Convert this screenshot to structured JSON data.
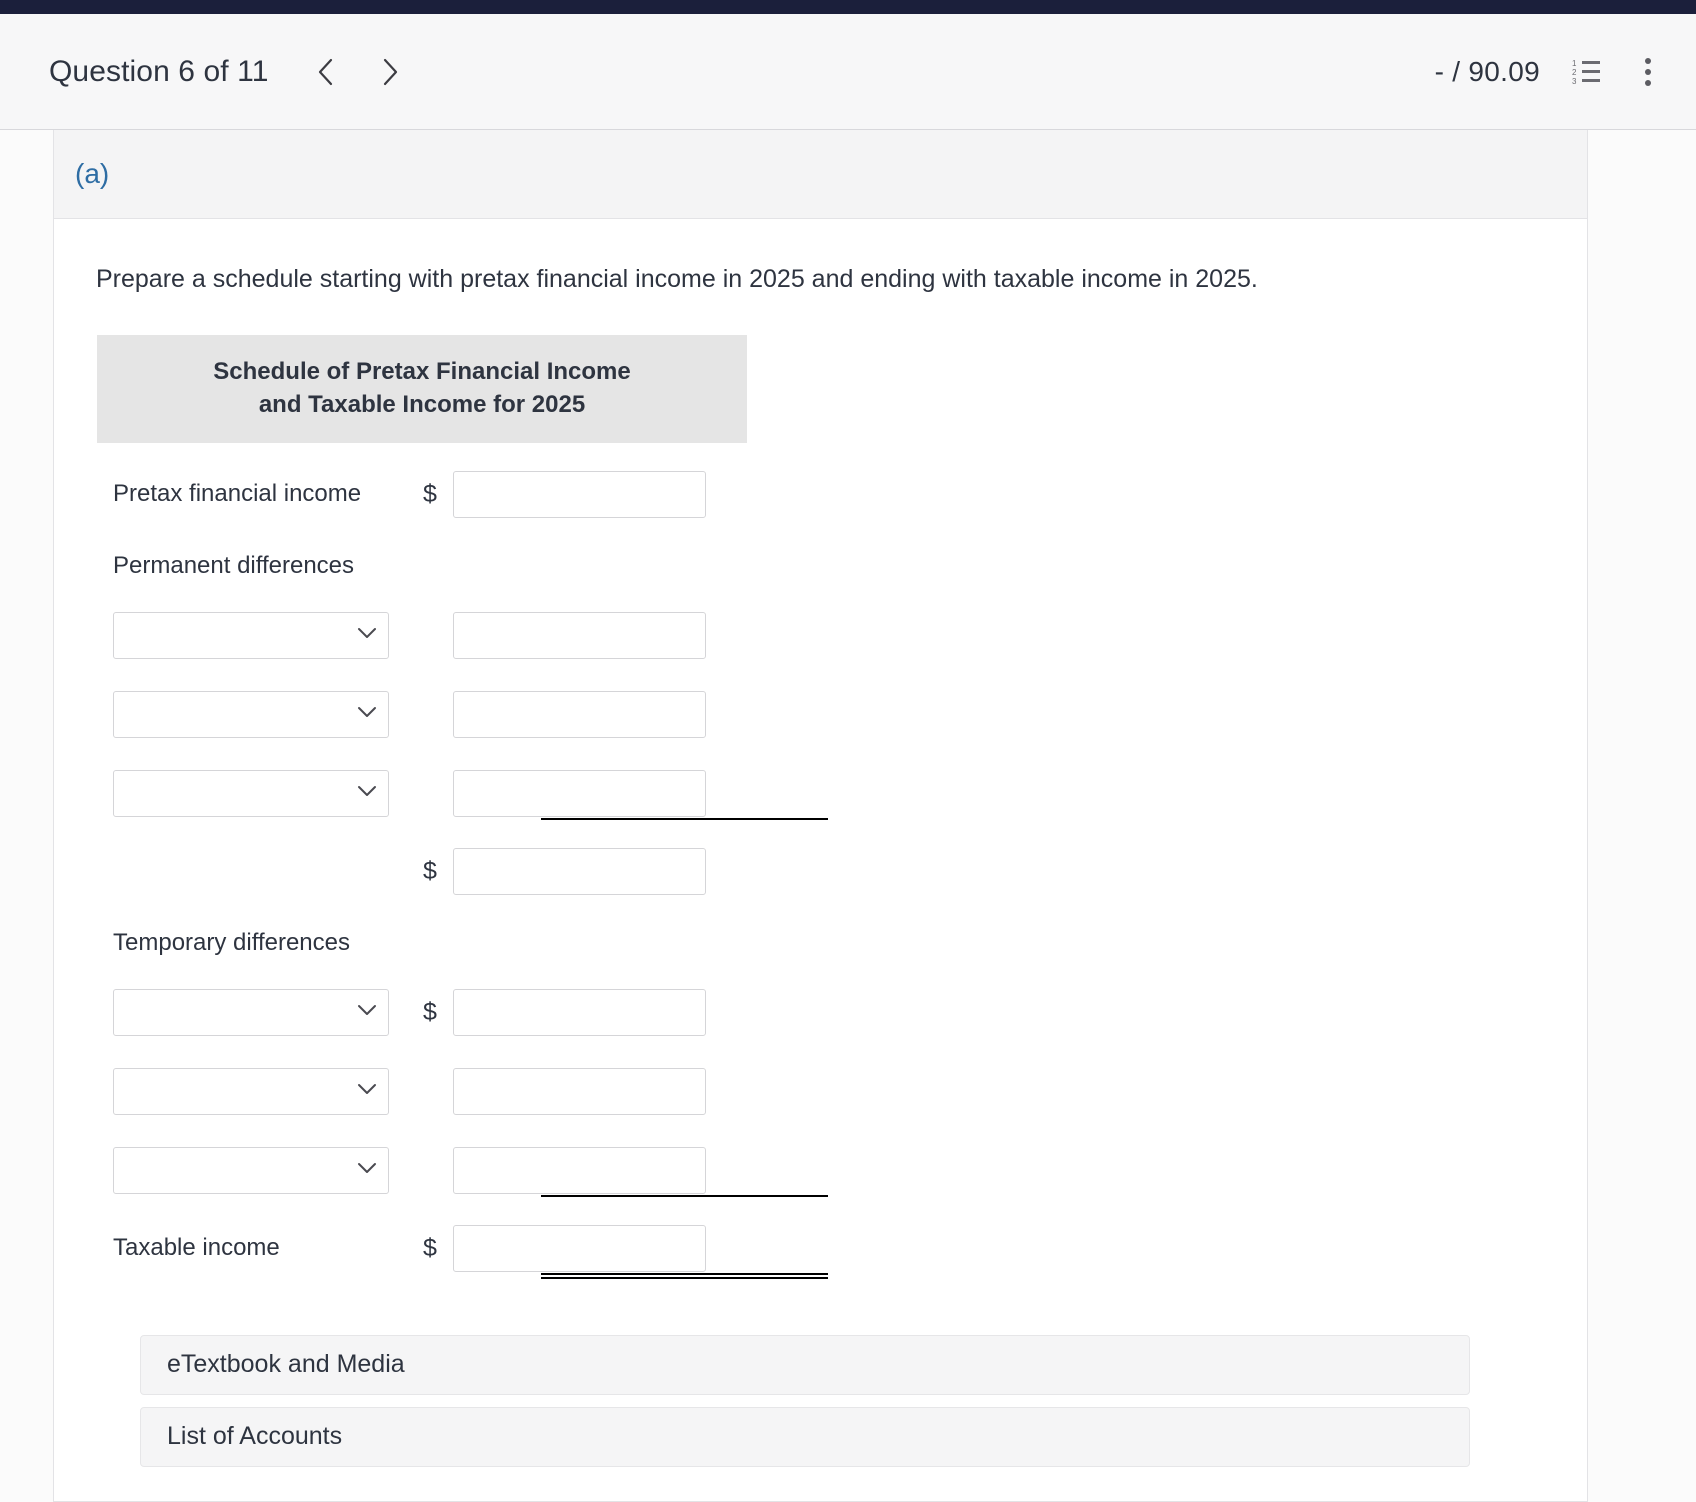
{
  "header": {
    "question_title": "Question 6 of 11",
    "prev_icon": "chevron-left-icon",
    "next_icon": "chevron-right-icon",
    "score": "- / 90.09",
    "list_icon": "numbered-list-icon",
    "menu_icon": "kebab-menu-icon"
  },
  "part": {
    "label": "(a)"
  },
  "content": {
    "instruction": "Prepare a schedule starting with pretax financial income in 2025 and ending with taxable income in 2025.",
    "schedule_title_line1": "Schedule of Pretax Financial Income",
    "schedule_title_line2": "and Taxable Income for 2025",
    "rows": {
      "pretax_label": "Pretax financial income",
      "pretax_dollar": "$",
      "pretax_value": "",
      "permanent_heading": "Permanent differences",
      "perm_1_select": "",
      "perm_1_value": "",
      "perm_2_select": "",
      "perm_2_value": "",
      "perm_3_select": "",
      "perm_3_value": "",
      "perm_subtotal_dollar": "$",
      "perm_subtotal_value": "",
      "temporary_heading": "Temporary differences",
      "temp_1_select": "",
      "temp_1_dollar": "$",
      "temp_1_value": "",
      "temp_2_select": "",
      "temp_2_value": "",
      "temp_3_select": "",
      "temp_3_value": "",
      "taxable_label": "Taxable income",
      "taxable_dollar": "$",
      "taxable_value": ""
    },
    "select_placeholder": ""
  },
  "footer": {
    "etextbook_button": "eTextbook and Media",
    "list_of_accounts_button": "List of Accounts"
  },
  "colors": {
    "top_strip": "#1b1f3b",
    "part_label_blue": "#2e6da4",
    "table_header_gray": "#e5e5e5",
    "button_gray": "#f5f5f6",
    "text": "#2e3440"
  }
}
